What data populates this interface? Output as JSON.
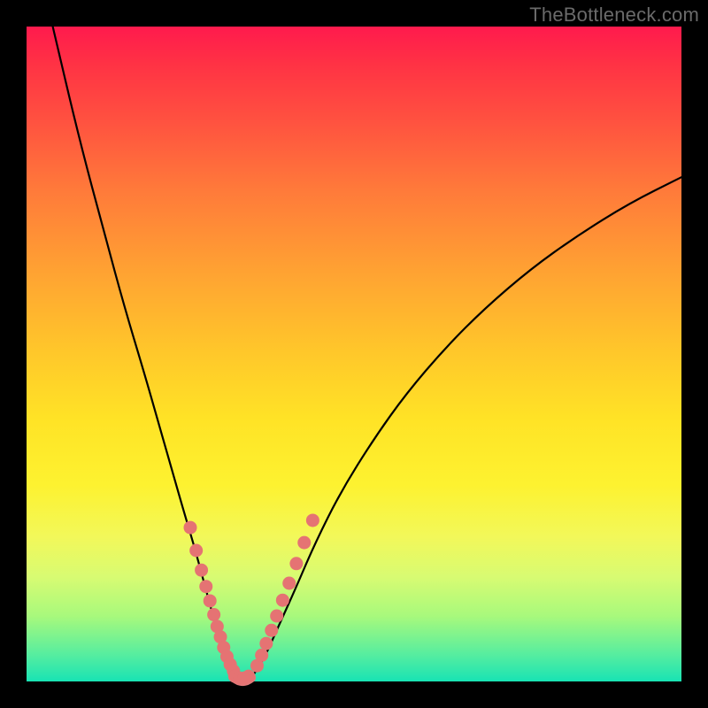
{
  "watermark": "TheBottleneck.com",
  "chart_data": {
    "type": "line",
    "title": "",
    "xlabel": "",
    "ylabel": "",
    "xlim": [
      0,
      100
    ],
    "ylim": [
      0,
      100
    ],
    "series": [
      {
        "name": "left-curve",
        "x": [
          4,
          8,
          12,
          15,
          18,
          20,
          22,
          24,
          25.5,
          27,
          28.2,
          29.2,
          30,
          30.8,
          31.4,
          32
        ],
        "values": [
          100,
          83,
          68,
          57,
          47,
          40,
          33,
          26,
          21,
          15.5,
          11,
          7.5,
          4.8,
          2.6,
          1.2,
          0.2
        ]
      },
      {
        "name": "right-curve",
        "x": [
          34,
          35,
          36.5,
          38.5,
          41,
          44,
          48,
          53,
          58,
          64,
          70,
          77,
          84,
          92,
          100
        ],
        "values": [
          0.2,
          1.5,
          4,
          8.5,
          14,
          21,
          29,
          37,
          44,
          51,
          57,
          63,
          68,
          73,
          77
        ]
      },
      {
        "name": "valley-floor",
        "x": [
          31.8,
          32.4,
          33.0,
          33.6,
          34.2
        ],
        "values": [
          0.6,
          0.2,
          0.1,
          0.2,
          0.6
        ]
      }
    ],
    "marker_groups": [
      {
        "name": "left-dots",
        "color": "#e57373",
        "points": [
          {
            "x": 25.0,
            "y": 23.5
          },
          {
            "x": 25.9,
            "y": 20.0
          },
          {
            "x": 26.7,
            "y": 17.0
          },
          {
            "x": 27.4,
            "y": 14.5
          },
          {
            "x": 28.0,
            "y": 12.3
          },
          {
            "x": 28.6,
            "y": 10.2
          },
          {
            "x": 29.1,
            "y": 8.4
          },
          {
            "x": 29.6,
            "y": 6.8
          },
          {
            "x": 30.1,
            "y": 5.2
          },
          {
            "x": 30.6,
            "y": 3.8
          },
          {
            "x": 31.1,
            "y": 2.6
          },
          {
            "x": 31.6,
            "y": 1.6
          }
        ]
      },
      {
        "name": "right-dots",
        "color": "#e57373",
        "points": [
          {
            "x": 35.2,
            "y": 2.4
          },
          {
            "x": 35.9,
            "y": 4.0
          },
          {
            "x": 36.6,
            "y": 5.8
          },
          {
            "x": 37.4,
            "y": 7.8
          },
          {
            "x": 38.2,
            "y": 10.0
          },
          {
            "x": 39.1,
            "y": 12.4
          },
          {
            "x": 40.1,
            "y": 15.0
          },
          {
            "x": 41.2,
            "y": 18.0
          },
          {
            "x": 42.4,
            "y": 21.2
          },
          {
            "x": 43.7,
            "y": 24.6
          }
        ]
      },
      {
        "name": "bottom-dots",
        "color": "#e57373",
        "points": [
          {
            "x": 31.8,
            "y": 0.8
          },
          {
            "x": 32.5,
            "y": 0.5
          },
          {
            "x": 33.2,
            "y": 0.5
          },
          {
            "x": 33.9,
            "y": 0.8
          }
        ]
      }
    ]
  }
}
